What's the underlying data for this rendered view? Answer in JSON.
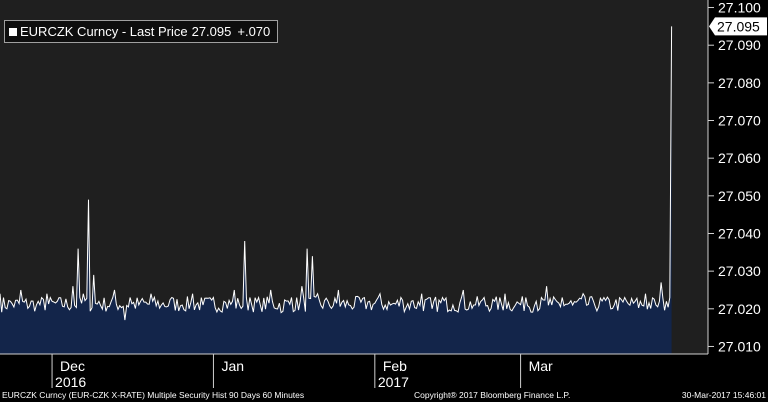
{
  "legend": {
    "series_label": "EURCZK Curncy - Last Price",
    "last_value": "27.095",
    "change": "+.070"
  },
  "footer": {
    "left": "EURCZK Curncy (EUR-CZK X-RATE) Multiple Security Hist   90 Days 60 Minutes",
    "center": "Copyright® 2017 Bloomberg Finance L.P.",
    "right": "30-Mar-2017 15:46:01"
  },
  "colors": {
    "background": "#1f1f1f",
    "area_fill": "#13254a",
    "line": "#ffffff",
    "last_price_tag": "#ffffff"
  },
  "chart_data": {
    "type": "area",
    "series": [
      {
        "name": "EURCZK Curncy - Last Price"
      }
    ],
    "x_months": [
      {
        "label": "Dec",
        "year": "2016",
        "start": "2016-12-01"
      },
      {
        "label": "Jan",
        "year": "",
        "start": "2017-01-01"
      },
      {
        "label": "Feb",
        "year": "2017",
        "start": "2017-02-01"
      },
      {
        "label": "Mar",
        "year": "",
        "start": "2017-03-01"
      }
    ],
    "x_range": [
      "2016-11-21",
      "2017-04-06"
    ],
    "ylim": [
      27.008,
      27.102
    ],
    "yticks": [
      "27.010",
      "27.020",
      "27.030",
      "27.040",
      "27.050",
      "27.060",
      "27.070",
      "27.080",
      "27.090",
      "27.100"
    ],
    "last_price": 27.095,
    "last_date": "2017-03-30",
    "baseline": 27.021,
    "points": [
      [
        "2016-11-21",
        27.024
      ],
      [
        "2016-11-23",
        27.022
      ],
      [
        "2016-11-25",
        27.025
      ],
      [
        "2016-11-28",
        27.021
      ],
      [
        "2016-11-30",
        27.024
      ],
      [
        "2016-12-02",
        27.022
      ],
      [
        "2016-12-05",
        27.026
      ],
      [
        "2016-12-06",
        27.036
      ],
      [
        "2016-12-07",
        27.024
      ],
      [
        "2016-12-08",
        27.049
      ],
      [
        "2016-12-09",
        27.029
      ],
      [
        "2016-12-10",
        27.022
      ],
      [
        "2016-12-13",
        27.025
      ],
      [
        "2016-12-15",
        27.017
      ],
      [
        "2016-12-16",
        27.023
      ],
      [
        "2016-12-18",
        27.022
      ],
      [
        "2016-12-20",
        27.024
      ],
      [
        "2016-12-22",
        27.021
      ],
      [
        "2016-12-24",
        27.023
      ],
      [
        "2016-12-26",
        27.021
      ],
      [
        "2016-12-28",
        27.024
      ],
      [
        "2016-12-30",
        27.021
      ],
      [
        "2017-01-01",
        27.023
      ],
      [
        "2017-01-03",
        27.022
      ],
      [
        "2017-01-05",
        27.025
      ],
      [
        "2017-01-06",
        27.021
      ],
      [
        "2017-01-07",
        27.038
      ],
      [
        "2017-01-08",
        27.023
      ],
      [
        "2017-01-10",
        27.021
      ],
      [
        "2017-01-12",
        27.025
      ],
      [
        "2017-01-14",
        27.019
      ],
      [
        "2017-01-16",
        27.023
      ],
      [
        "2017-01-18",
        27.026
      ],
      [
        "2017-01-19",
        27.036
      ],
      [
        "2017-01-20",
        27.034
      ],
      [
        "2017-01-21",
        27.024
      ],
      [
        "2017-01-23",
        27.022
      ],
      [
        "2017-01-25",
        27.025
      ],
      [
        "2017-01-27",
        27.021
      ],
      [
        "2017-01-29",
        27.023
      ],
      [
        "2017-01-31",
        27.022
      ],
      [
        "2017-02-02",
        27.024
      ],
      [
        "2017-02-04",
        27.021
      ],
      [
        "2017-02-06",
        27.023
      ],
      [
        "2017-02-08",
        27.022
      ],
      [
        "2017-02-10",
        27.024
      ],
      [
        "2017-02-12",
        27.02
      ],
      [
        "2017-02-14",
        27.023
      ],
      [
        "2017-02-16",
        27.021
      ],
      [
        "2017-02-18",
        27.025
      ],
      [
        "2017-02-20",
        27.021
      ],
      [
        "2017-02-22",
        27.023
      ],
      [
        "2017-02-24",
        27.022
      ],
      [
        "2017-02-26",
        27.024
      ],
      [
        "2017-02-28",
        27.021
      ],
      [
        "2017-03-02",
        27.023
      ],
      [
        "2017-03-04",
        27.022
      ],
      [
        "2017-03-06",
        27.026
      ],
      [
        "2017-03-07",
        27.021
      ],
      [
        "2017-03-09",
        27.023
      ],
      [
        "2017-03-11",
        27.021
      ],
      [
        "2017-03-13",
        27.024
      ],
      [
        "2017-03-15",
        27.022
      ],
      [
        "2017-03-17",
        27.023
      ],
      [
        "2017-03-19",
        27.021
      ],
      [
        "2017-03-21",
        27.023
      ],
      [
        "2017-03-23",
        27.022
      ],
      [
        "2017-03-25",
        27.024
      ],
      [
        "2017-03-27",
        27.021
      ],
      [
        "2017-03-28",
        27.027
      ],
      [
        "2017-03-29",
        27.022
      ],
      [
        "2017-03-30",
        27.095
      ]
    ]
  }
}
